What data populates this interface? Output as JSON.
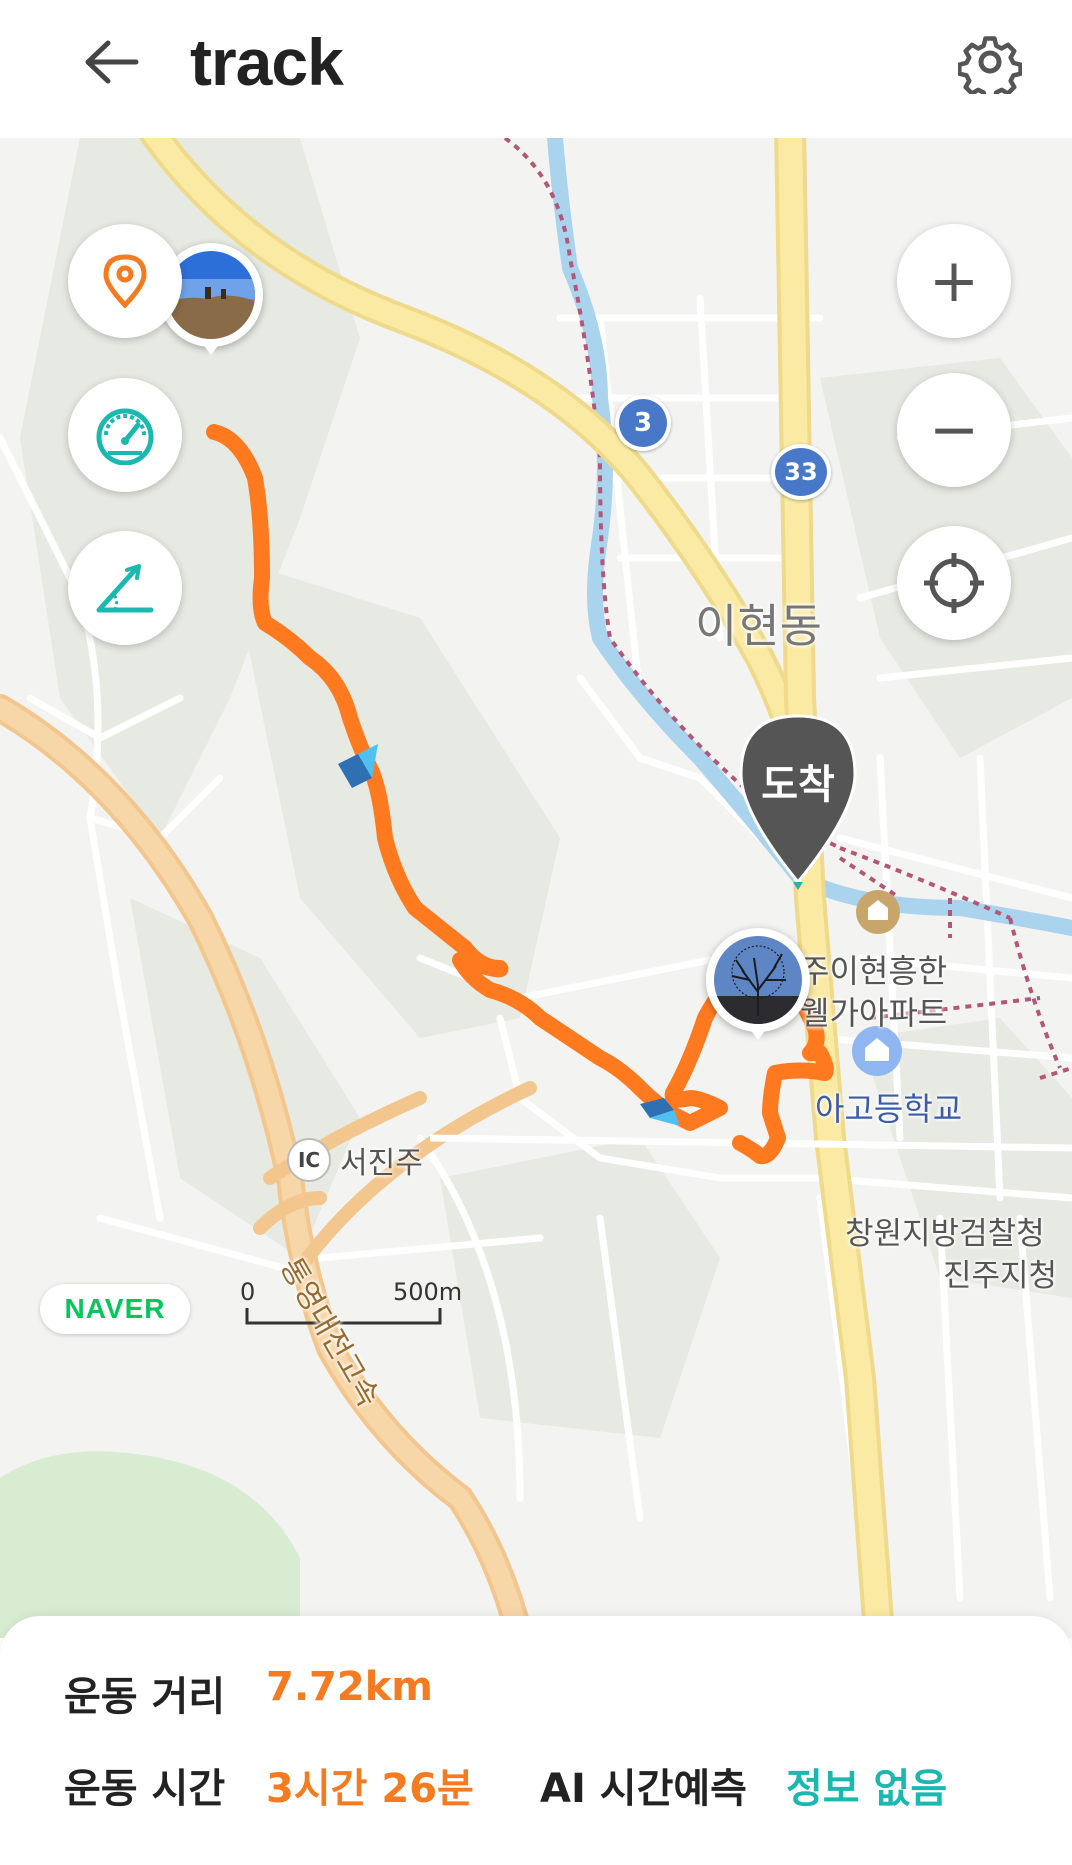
{
  "header": {
    "title": "track",
    "back_icon": "arrow-left-icon",
    "settings_icon": "gear-icon"
  },
  "map": {
    "labels": {
      "district": "이현동",
      "apartment_line1": "주이현흥한",
      "apartment_line2": "웰가아파트",
      "school": "아고등학교",
      "ic_badge": "IC",
      "ic_name": "서진주",
      "expressway": "통영대전고속",
      "prosecutor_line1": "창원지방검찰청",
      "prosecutor_line2": "진주지청",
      "route_3": "3",
      "route_33": "33",
      "arrival": "도착"
    },
    "scale": {
      "zero": "0",
      "distance": "500m"
    },
    "naver_logo": "NAVER",
    "buttons": {
      "location": "location-pin-icon",
      "speed": "speedometer-icon",
      "slope": "slope-icon",
      "zoom_in": "+",
      "zoom_out": "−",
      "my_location": "crosshair-icon"
    }
  },
  "stats": {
    "distance_label": "운동 거리",
    "distance_value": "7.72km",
    "time_label": "운동 시간",
    "time_value": "3시간 26분",
    "ai_label": "AI 시간예측",
    "ai_value": "정보 없음"
  },
  "colors": {
    "track": "#ff7a1f",
    "accent_orange": "#f47b20",
    "accent_teal": "#1bb8b0",
    "arrival_marker": "#555555",
    "naver_green": "#03c75a"
  }
}
